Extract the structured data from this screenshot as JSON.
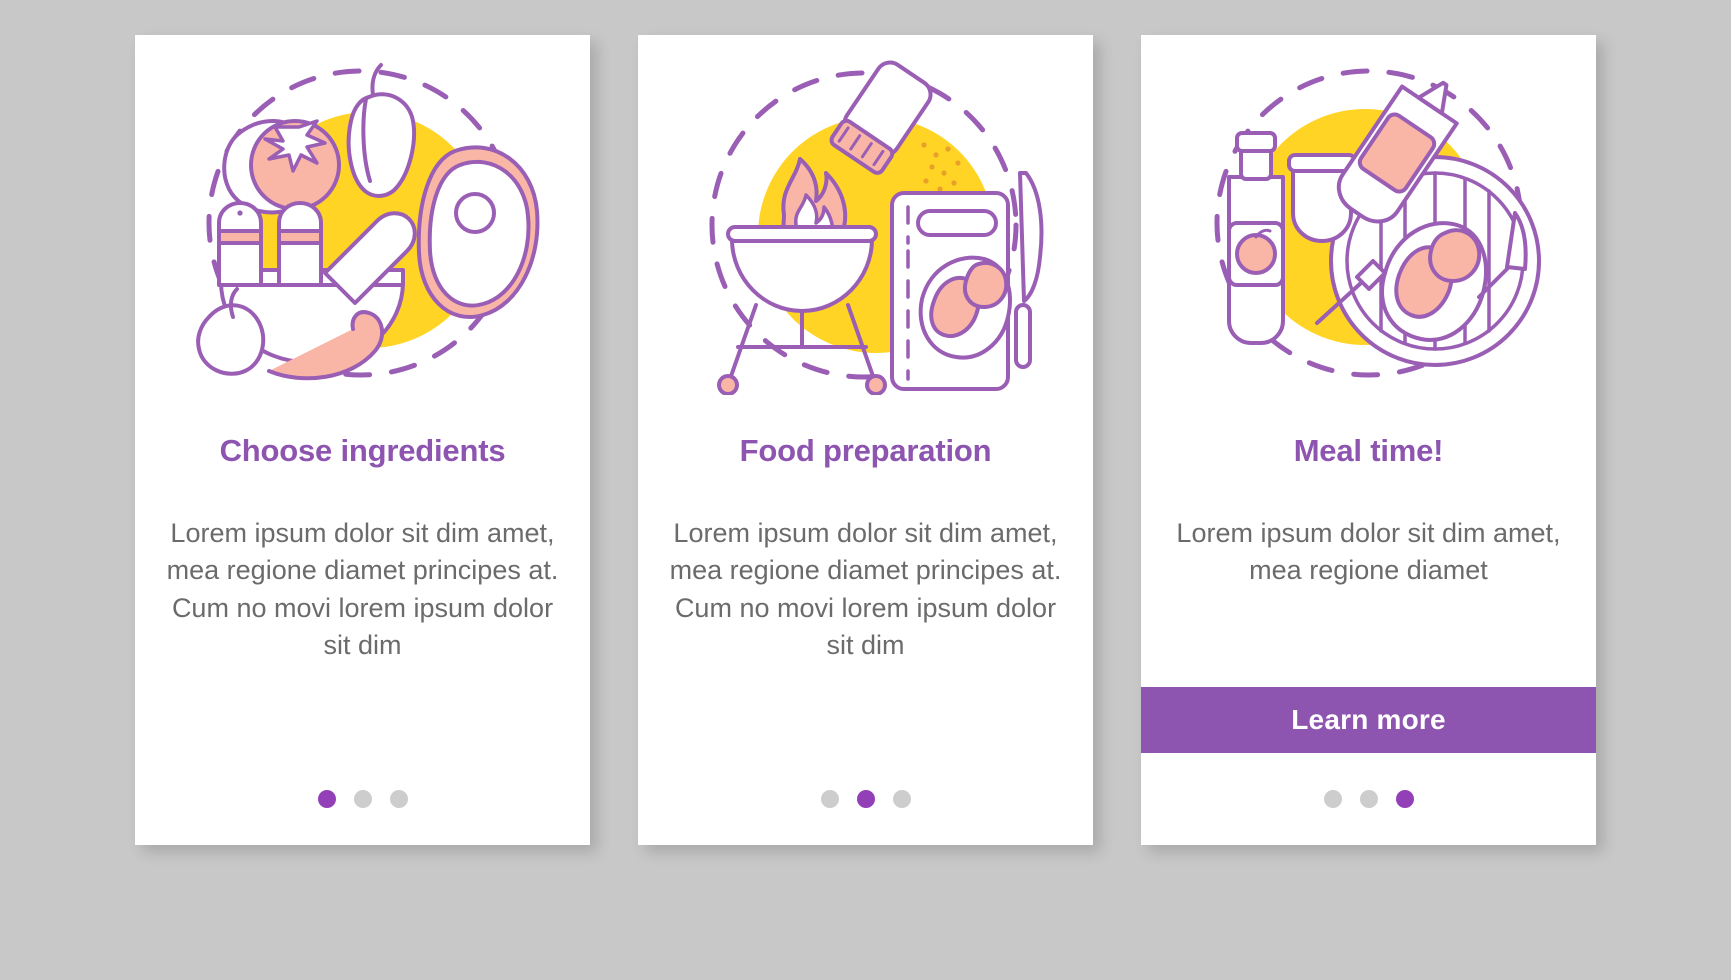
{
  "background_color": "#c8c8c8",
  "palette": {
    "accent_purple": "#8d54b0",
    "dot_active": "#9340b8",
    "dot_inactive": "#cdcdcd",
    "body_text": "#6b6b6b",
    "card_background": "#ffffff",
    "illustration_line": "#9a5fb5",
    "illustration_pink": "#f9b6a6",
    "illustration_yellow": "#ffd424"
  },
  "body_text_shared": "Lorem ipsum dolor sit dim amet, mea regione diamet principes at. Cum no movi lorem ipsum dolor sit dim",
  "cards": [
    {
      "id": "choose-ingredients",
      "title": "Choose ingredients",
      "body": "Lorem ipsum dolor sit dim amet, mea regione diamet principes at. Cum no movi lorem ipsum dolor sit dim",
      "illustration_name": "ingredients-illustration",
      "has_cta": false,
      "cta_label": "",
      "dots": [
        {
          "active": true
        },
        {
          "active": false
        },
        {
          "active": false
        }
      ]
    },
    {
      "id": "food-preparation",
      "title": "Food preparation",
      "body": "Lorem ipsum dolor sit dim amet, mea regione diamet principes at. Cum no movi lorem ipsum dolor sit dim",
      "illustration_name": "grill-illustration",
      "has_cta": false,
      "cta_label": "",
      "dots": [
        {
          "active": false
        },
        {
          "active": true
        },
        {
          "active": false
        }
      ]
    },
    {
      "id": "meal-time",
      "title": "Meal time!",
      "body": "Lorem ipsum dolor sit dim amet, mea regione diamet",
      "illustration_name": "meal-illustration",
      "has_cta": true,
      "cta_label": "Learn more",
      "dots": [
        {
          "active": false
        },
        {
          "active": false
        },
        {
          "active": true
        }
      ]
    }
  ]
}
